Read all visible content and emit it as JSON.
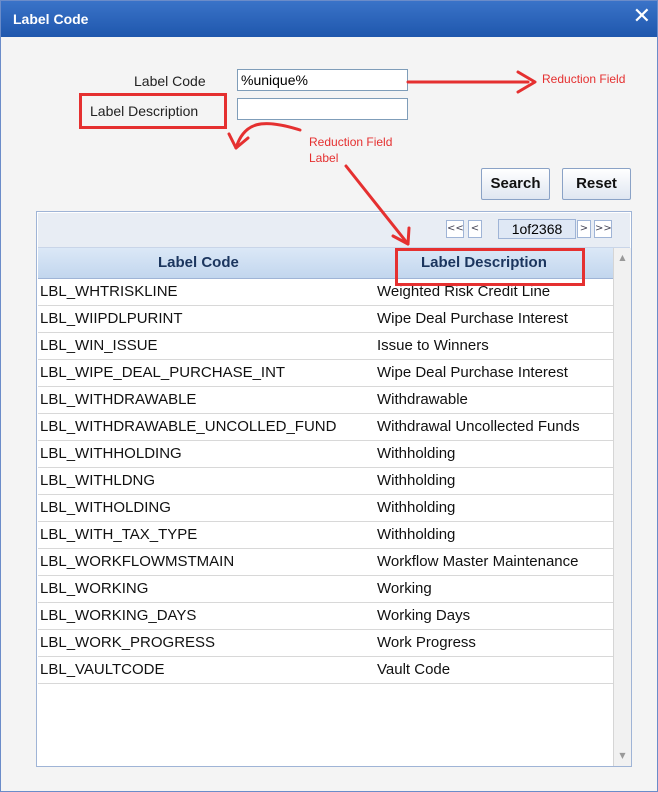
{
  "window": {
    "title": "Label Code",
    "close_glyph": "✕"
  },
  "form": {
    "label_code": "Label Code",
    "label_code_value": "%unique%",
    "label_description": "Label Description",
    "label_description_value": ""
  },
  "annotations": {
    "reduction_field": "Reduction Field",
    "reduction_field_label_line1": "Reduction Field",
    "reduction_field_label_line2": "Label",
    "color": "#e53030"
  },
  "buttons": {
    "search": "Search",
    "reset": "Reset"
  },
  "pager": {
    "first": "<<",
    "prev": "<",
    "info": "1of2368",
    "next": ">",
    "last": ">>"
  },
  "table": {
    "headers": [
      "Label Code",
      "Label Description"
    ],
    "rows": [
      [
        "LBL_WHTRISKLINE",
        "Weighted Risk Credit Line"
      ],
      [
        "LBL_WIIPDLPURINT",
        "Wipe Deal Purchase Interest"
      ],
      [
        "LBL_WIN_ISSUE",
        "Issue to Winners"
      ],
      [
        "LBL_WIPE_DEAL_PURCHASE_INT",
        "Wipe Deal Purchase Interest"
      ],
      [
        "LBL_WITHDRAWABLE",
        "Withdrawable"
      ],
      [
        "LBL_WITHDRAWABLE_UNCOLLED_FUND",
        "Withdrawal Uncollected Funds"
      ],
      [
        "LBL_WITHHOLDING",
        "Withholding"
      ],
      [
        "LBL_WITHLDNG",
        "Withholding"
      ],
      [
        "LBL_WITHOLDING",
        "Withholding"
      ],
      [
        "LBL_WITH_TAX_TYPE",
        "Withholding"
      ],
      [
        "LBL_WORKFLOWMSTMAIN",
        "Workflow Master Maintenance"
      ],
      [
        "LBL_WORKING",
        "Working"
      ],
      [
        "LBL_WORKING_DAYS",
        "Working Days"
      ],
      [
        "LBL_WORK_PROGRESS",
        "Work Progress"
      ],
      [
        "LBL_VAULTCODE",
        "Vault Code"
      ]
    ]
  },
  "colors": {
    "titlebar": "#2a64bc",
    "header_text": "#1b355e",
    "annotation": "#e53030"
  }
}
